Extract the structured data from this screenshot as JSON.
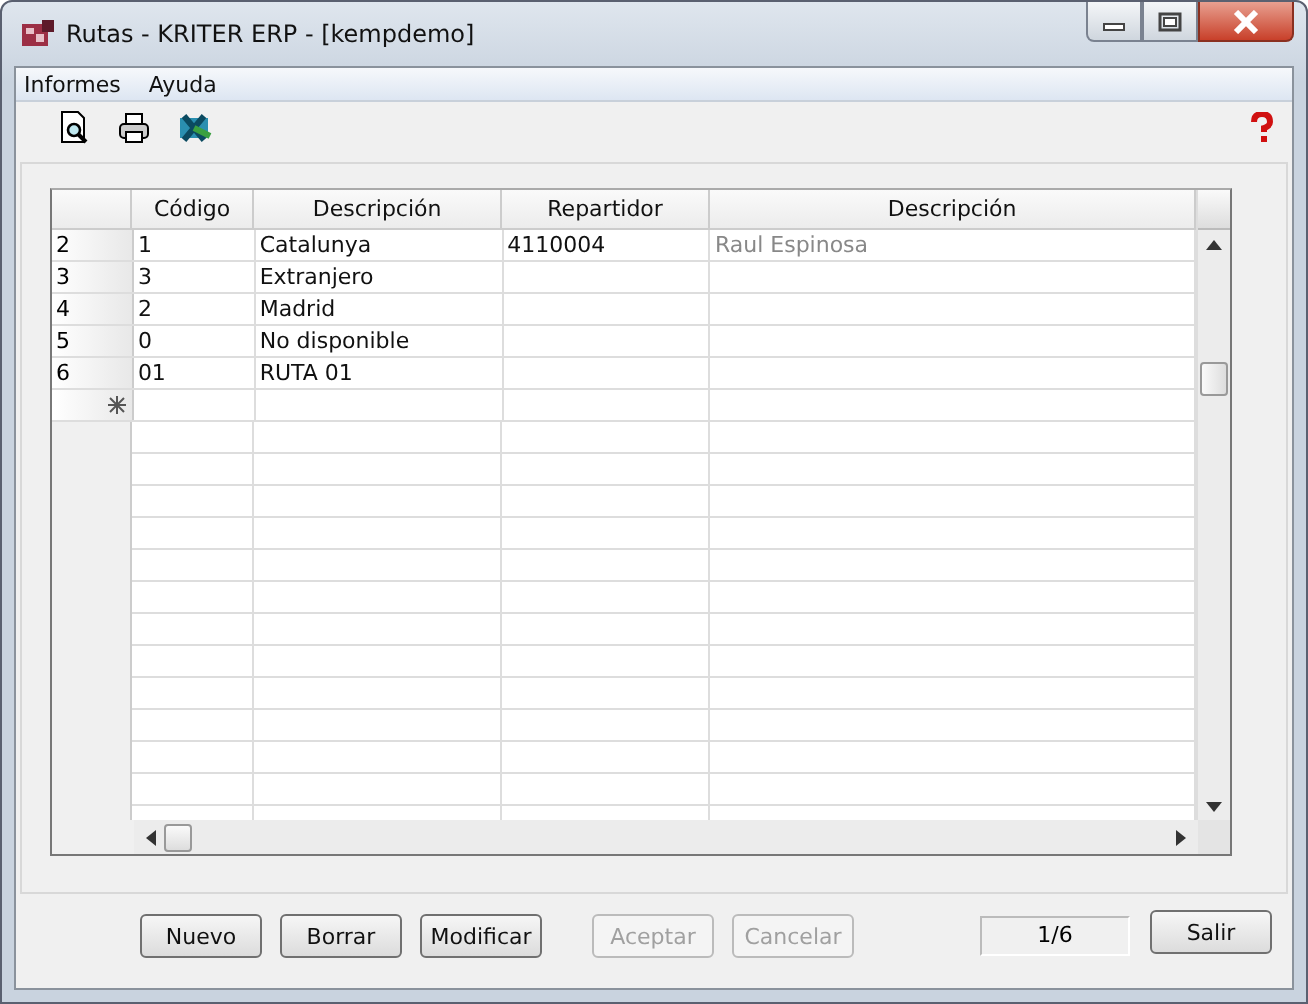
{
  "window": {
    "title": "Rutas - KRITER ERP - [kempdemo]"
  },
  "menu": [
    {
      "label": "Informes"
    },
    {
      "label": "Ayuda"
    }
  ],
  "table": {
    "columns": [
      {
        "label": "Código",
        "disabled": false
      },
      {
        "label": "Descripción",
        "disabled": false
      },
      {
        "label": "Repartidor",
        "disabled": false
      },
      {
        "label": "Descripción",
        "disabled": true
      }
    ],
    "rows": [
      {
        "number": "2",
        "cells": [
          "1",
          "Catalunya",
          "4110004",
          "Raul Espinosa"
        ]
      },
      {
        "number": "3",
        "cells": [
          "3",
          "Extranjero",
          "",
          ""
        ]
      },
      {
        "number": "4",
        "cells": [
          "2",
          "Madrid",
          "",
          ""
        ]
      },
      {
        "number": "5",
        "cells": [
          "0",
          "No disponible",
          "",
          ""
        ]
      },
      {
        "number": "6",
        "cells": [
          "01",
          "RUTA 01",
          "",
          ""
        ]
      }
    ]
  },
  "buttons": [
    {
      "label": "Nuevo",
      "disabled": false
    },
    {
      "label": "Borrar",
      "disabled": false
    },
    {
      "label": "Modificar",
      "disabled": false
    },
    {
      "label": "Aceptar",
      "disabled": true
    },
    {
      "label": "Cancelar",
      "disabled": true
    }
  ],
  "record_counter": "1/6",
  "exit_button": {
    "label": "Salir",
    "disabled": false
  }
}
